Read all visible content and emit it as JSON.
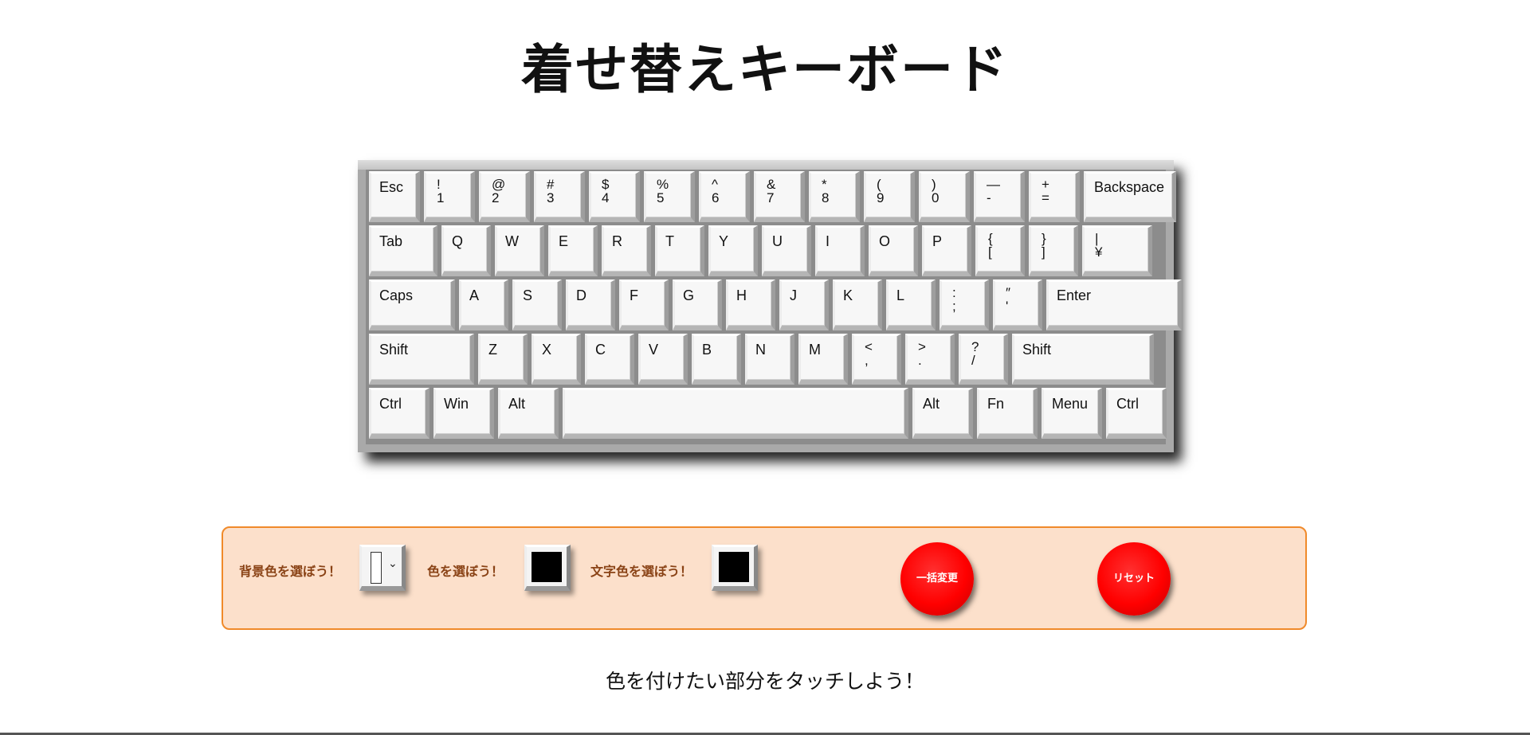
{
  "title": "着せ替えキーボード",
  "keyboard": {
    "rows": [
      [
        {
          "label": "Esc",
          "w": 64
        },
        {
          "top": "!",
          "bottom": "1",
          "w": 64
        },
        {
          "top": "@",
          "bottom": "2",
          "w": 64
        },
        {
          "top": "#",
          "bottom": "3",
          "w": 64
        },
        {
          "top": "$",
          "bottom": "4",
          "w": 64
        },
        {
          "top": "%",
          "bottom": "5",
          "w": 64
        },
        {
          "top": "^",
          "bottom": "6",
          "w": 64
        },
        {
          "top": "&",
          "bottom": "7",
          "w": 64
        },
        {
          "top": "*",
          "bottom": "8",
          "w": 64
        },
        {
          "top": "(",
          "bottom": "9",
          "w": 64
        },
        {
          "top": ")",
          "bottom": "0",
          "w": 64
        },
        {
          "top": "—",
          "bottom": "-",
          "w": 64
        },
        {
          "top": "+",
          "bottom": "=",
          "w": 64
        },
        {
          "label": "Backspace",
          "w": 116
        }
      ],
      [
        {
          "label": "Tab",
          "w": 86
        },
        {
          "label": "Q",
          "w": 62
        },
        {
          "label": "W",
          "w": 62
        },
        {
          "label": "E",
          "w": 62
        },
        {
          "label": "R",
          "w": 62
        },
        {
          "label": "T",
          "w": 62
        },
        {
          "label": "Y",
          "w": 62
        },
        {
          "label": "U",
          "w": 62
        },
        {
          "label": "I",
          "w": 62
        },
        {
          "label": "O",
          "w": 62
        },
        {
          "label": "P",
          "w": 62
        },
        {
          "top": "{",
          "bottom": "[",
          "w": 62
        },
        {
          "top": "}",
          "bottom": "]",
          "w": 62
        },
        {
          "top": "|",
          "bottom": "¥",
          "w": 88
        }
      ],
      [
        {
          "label": "Caps",
          "w": 108
        },
        {
          "label": "A",
          "w": 62
        },
        {
          "label": "S",
          "w": 62
        },
        {
          "label": "D",
          "w": 62
        },
        {
          "label": "F",
          "w": 62
        },
        {
          "label": "G",
          "w": 62
        },
        {
          "label": "H",
          "w": 62
        },
        {
          "label": "J",
          "w": 62
        },
        {
          "label": "K",
          "w": 62
        },
        {
          "label": "L",
          "w": 62
        },
        {
          "top": ":",
          "bottom": ";",
          "w": 62
        },
        {
          "top": "″",
          "bottom": "'",
          "w": 62
        },
        {
          "label": "Enter",
          "w": 170
        }
      ],
      [
        {
          "label": "Shift",
          "w": 132
        },
        {
          "label": "Z",
          "w": 62
        },
        {
          "label": "X",
          "w": 62
        },
        {
          "label": "C",
          "w": 62
        },
        {
          "label": "V",
          "w": 62
        },
        {
          "label": "B",
          "w": 62
        },
        {
          "label": "N",
          "w": 62
        },
        {
          "label": "M",
          "w": 62
        },
        {
          "top": "<",
          "bottom": ",",
          "w": 62
        },
        {
          "top": ">",
          "bottom": ".",
          "w": 62
        },
        {
          "top": "?",
          "bottom": "/",
          "w": 62
        },
        {
          "label": "Shift",
          "w": 178
        }
      ],
      [
        {
          "label": "Ctrl",
          "w": 76
        },
        {
          "label": "Win",
          "w": 76
        },
        {
          "label": "Alt",
          "w": 76
        },
        {
          "label": "",
          "w": 434
        },
        {
          "label": "Alt",
          "w": 76
        },
        {
          "label": "Fn",
          "w": 76
        },
        {
          "label": "Menu",
          "w": 76
        },
        {
          "label": "Ctrl",
          "w": 76
        }
      ]
    ]
  },
  "controls": {
    "bg_label": "背景色を選ぼう！",
    "key_label": "色を選ぼう！",
    "text_label": "文字色を選ぼう！",
    "key_color": "#000000",
    "text_color": "#000000",
    "bulk_button": "一括変更",
    "reset_button": "リセット"
  },
  "hint": "色を付けたい部分をタッチしよう！"
}
